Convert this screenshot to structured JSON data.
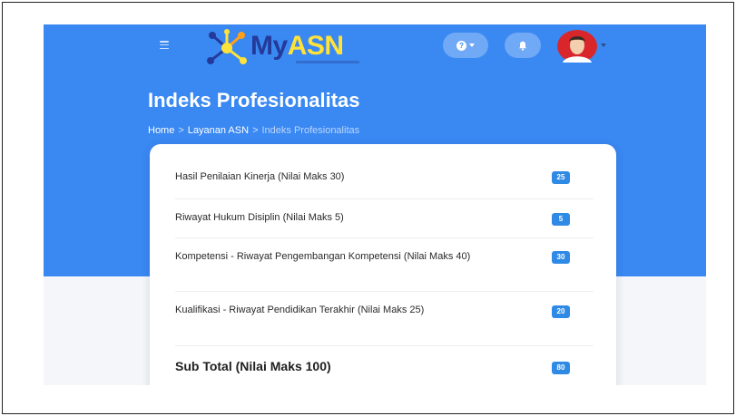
{
  "header": {
    "logo": {
      "prefix": "My",
      "emphasis": "ASN"
    },
    "help_icon": "question-circle-icon",
    "bell_icon": "bell-icon",
    "avatar_icon": "user-avatar"
  },
  "page": {
    "title": "Indeks Profesionalitas",
    "breadcrumb": [
      "Home",
      "Layanan ASN",
      "Indeks Profesionalitas"
    ],
    "breadcrumb_separator": ">"
  },
  "scores": [
    {
      "label": "Hasil Penilaian Kinerja (Nilai Maks 30)",
      "value": "25"
    },
    {
      "label": "Riwayat Hukum Disiplin (Nilai Maks 5)",
      "value": "5"
    },
    {
      "label": "Kompetensi - Riwayat Pengembangan Kompetensi (Nilai Maks 40)",
      "value": "30"
    },
    {
      "label": "Kualifikasi - Riwayat Pendidikan Terakhir (Nilai Maks 25)",
      "value": "20"
    }
  ],
  "total": {
    "label": "Sub Total (Nilai Maks 100)",
    "value": "80"
  },
  "colors": {
    "header_bg": "#3a88f2",
    "badge": "#2f8ae6",
    "logo_primary": "#243a9b",
    "logo_accent": "#ffe23a"
  }
}
